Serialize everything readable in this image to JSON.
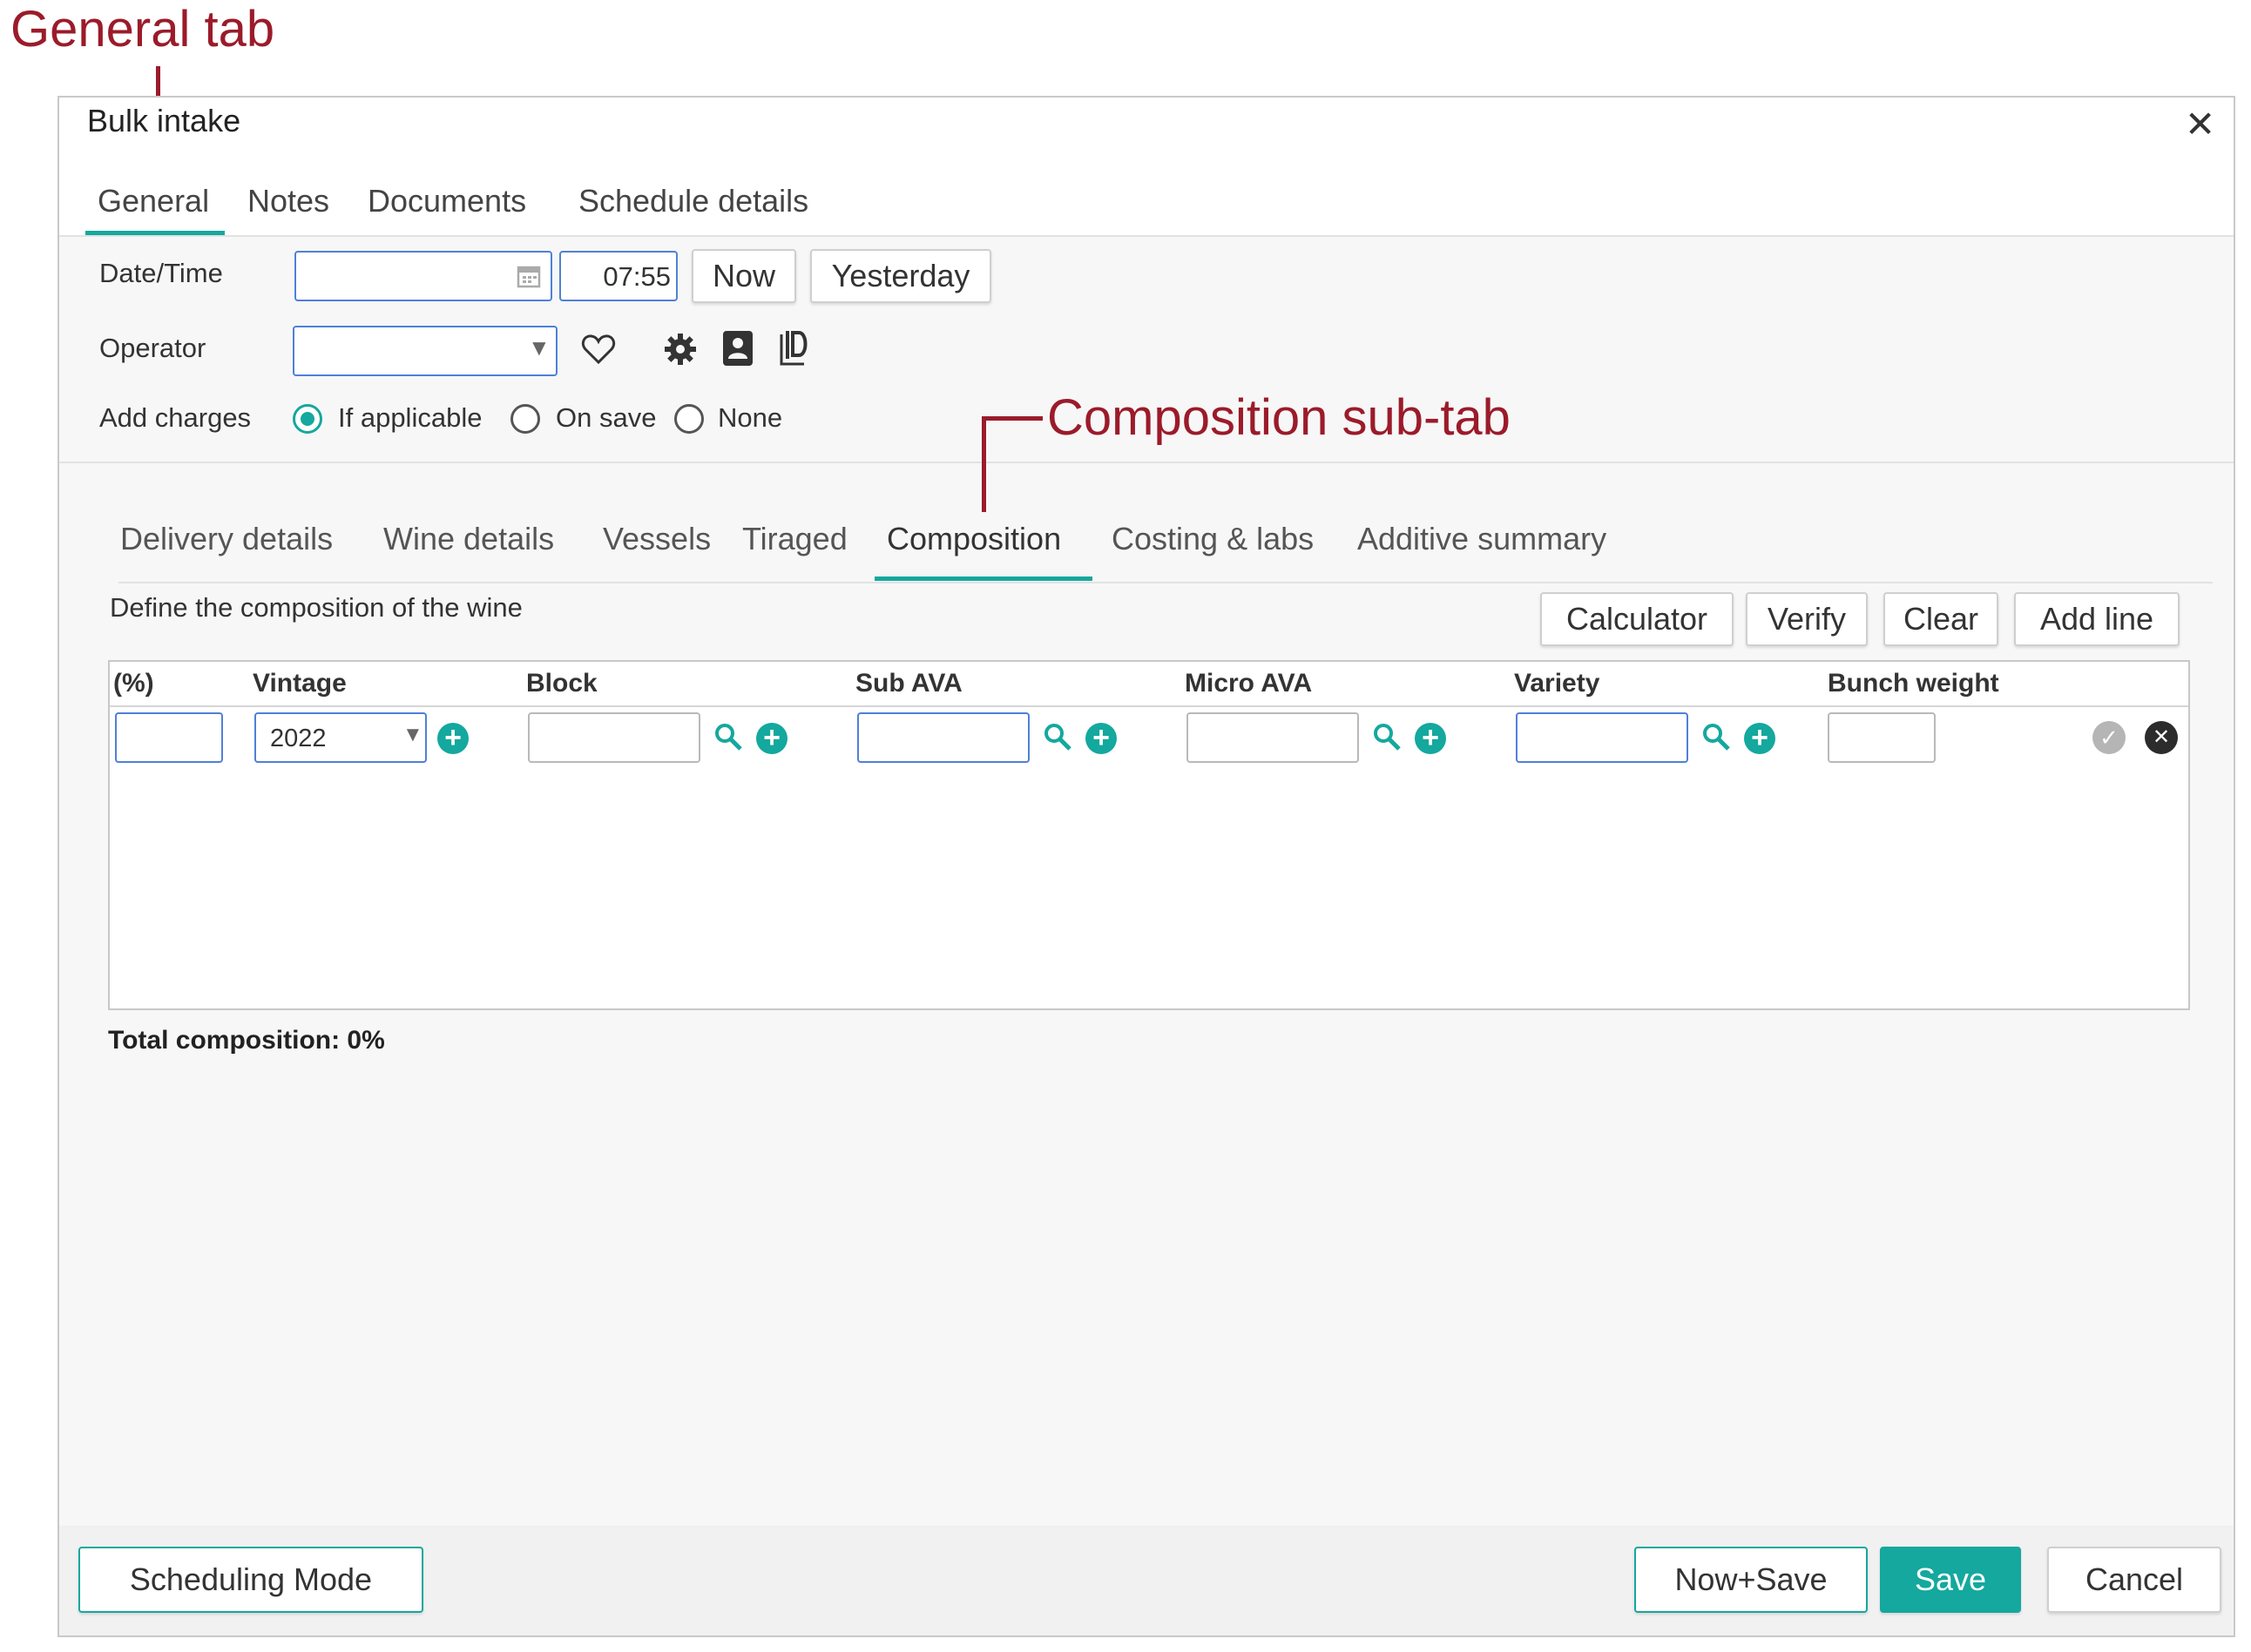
{
  "annotations": {
    "general_tab": "General tab",
    "composition_sub_tab": "Composition sub-tab"
  },
  "dialog": {
    "title": "Bulk intake",
    "close_icon": "close-icon"
  },
  "main_tabs": [
    {
      "label": "General",
      "active": true
    },
    {
      "label": "Notes",
      "active": false
    },
    {
      "label": "Documents",
      "active": false
    },
    {
      "label": "Schedule details",
      "active": false
    }
  ],
  "general": {
    "datetime_label": "Date/Time",
    "date_value": "",
    "calendar_icon": "calendar-icon",
    "time_value": "07:55",
    "now_button": "Now",
    "yesterday_button": "Yesterday",
    "operator_label": "Operator",
    "operator_value": "",
    "operator_icons": [
      "heart-icon",
      "gear-icon",
      "contact-card-icon",
      "id-document-icon"
    ],
    "add_charges_label": "Add charges",
    "charge_options": [
      {
        "label": "If applicable",
        "selected": true
      },
      {
        "label": "On save",
        "selected": false
      },
      {
        "label": "None",
        "selected": false
      }
    ]
  },
  "sub_tabs": [
    {
      "label": "Delivery details",
      "active": false
    },
    {
      "label": "Wine details",
      "active": false
    },
    {
      "label": "Vessels",
      "active": false
    },
    {
      "label": "Tiraged",
      "active": false
    },
    {
      "label": "Composition",
      "active": true
    },
    {
      "label": "Costing & labs",
      "active": false
    },
    {
      "label": "Additive summary",
      "active": false
    }
  ],
  "composition": {
    "description": "Define the composition of the wine",
    "buttons": {
      "calculator": "Calculator",
      "verify": "Verify",
      "clear": "Clear",
      "add_line": "Add line"
    },
    "columns": [
      "(%)",
      "Vintage",
      "Block",
      "Sub AVA",
      "Micro AVA",
      "Variety",
      "Bunch weight"
    ],
    "row": {
      "percent": "",
      "vintage": "2022",
      "block": "",
      "sub_ava": "",
      "micro_ava": "",
      "variety": "",
      "bunch_weight": ""
    },
    "total": "Total composition: 0%"
  },
  "footer": {
    "scheduling_mode": "Scheduling Mode",
    "now_save": "Now+Save",
    "save": "Save",
    "cancel": "Cancel"
  },
  "colors": {
    "accent": "#14a89e",
    "annotation": "#9b1b2a",
    "input_focus_border": "#4f80d8"
  }
}
